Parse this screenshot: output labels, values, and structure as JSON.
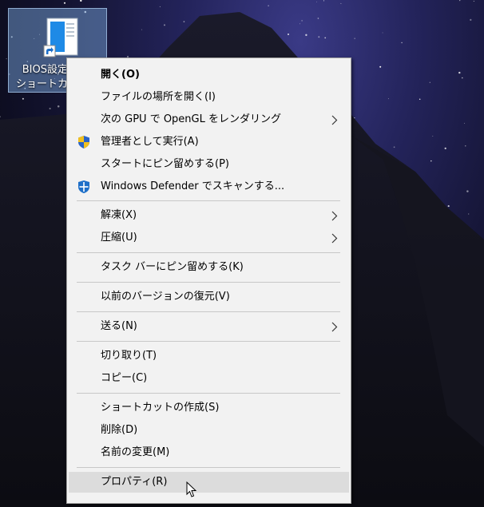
{
  "desktop": {
    "icon": {
      "label_line1": "BIOS設定",
      "label_line2": "ショートカ",
      "glyph": "document-shortcut-icon"
    }
  },
  "menu": {
    "open": "開く(O)",
    "open_location": "ファイルの場所を開く(I)",
    "gpu": "次の GPU で OpenGL をレンダリング",
    "run_admin": "管理者として実行(A)",
    "pin_start": "スタートにピン留めする(P)",
    "defender_scan": "Windows Defender でスキャンする...",
    "extract": "解凍(X)",
    "compress": "圧縮(U)",
    "pin_taskbar": "タスク バーにピン留めする(K)",
    "restore_versions": "以前のバージョンの復元(V)",
    "send_to": "送る(N)",
    "cut": "切り取り(T)",
    "copy": "コピー(C)",
    "create_shortcut": "ショートカットの作成(S)",
    "delete": "削除(D)",
    "rename": "名前の変更(M)",
    "properties": "プロパティ(R)"
  },
  "colors": {
    "menu_bg": "#f2f2f2",
    "hover_bg": "#dcdcdc",
    "selection": "#6e96c8",
    "shield_blue": "#1e6fc8",
    "uac_yellow": "#f0c020"
  }
}
